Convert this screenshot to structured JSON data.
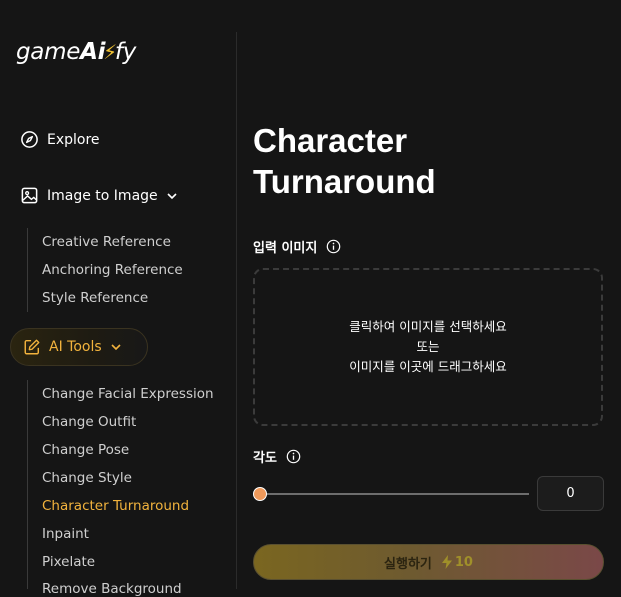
{
  "logo": {
    "prefix": "game",
    "ai": "Ai",
    "suffix": "fy"
  },
  "sidebar": {
    "explore": "Explore",
    "image_to_image": {
      "label": "Image to Image",
      "items": [
        "Creative Reference",
        "Anchoring Reference",
        "Style Reference"
      ]
    },
    "ai_tools": {
      "label": "AI Tools",
      "items": [
        "Change Facial Expression",
        "Change Outfit",
        "Change Pose",
        "Change Style",
        "Character Turnaround",
        "Inpaint",
        "Pixelate",
        "Remove Background"
      ],
      "active_index": 4
    }
  },
  "main": {
    "title_line1": "Character",
    "title_line2": "Turnaround",
    "input_image_label": "입력 이미지",
    "dropzone": {
      "line1": "클릭하여 이미지를 선택하세요",
      "line2": "또는",
      "line3": "이미지를 이곳에 드래그하세요"
    },
    "angle_label": "각도",
    "angle_value": "0",
    "angle_fraction": 0,
    "run_button": {
      "label": "실행하기",
      "cost": "10"
    }
  },
  "colors": {
    "accent": "#f2b33d",
    "background": "#151515"
  }
}
